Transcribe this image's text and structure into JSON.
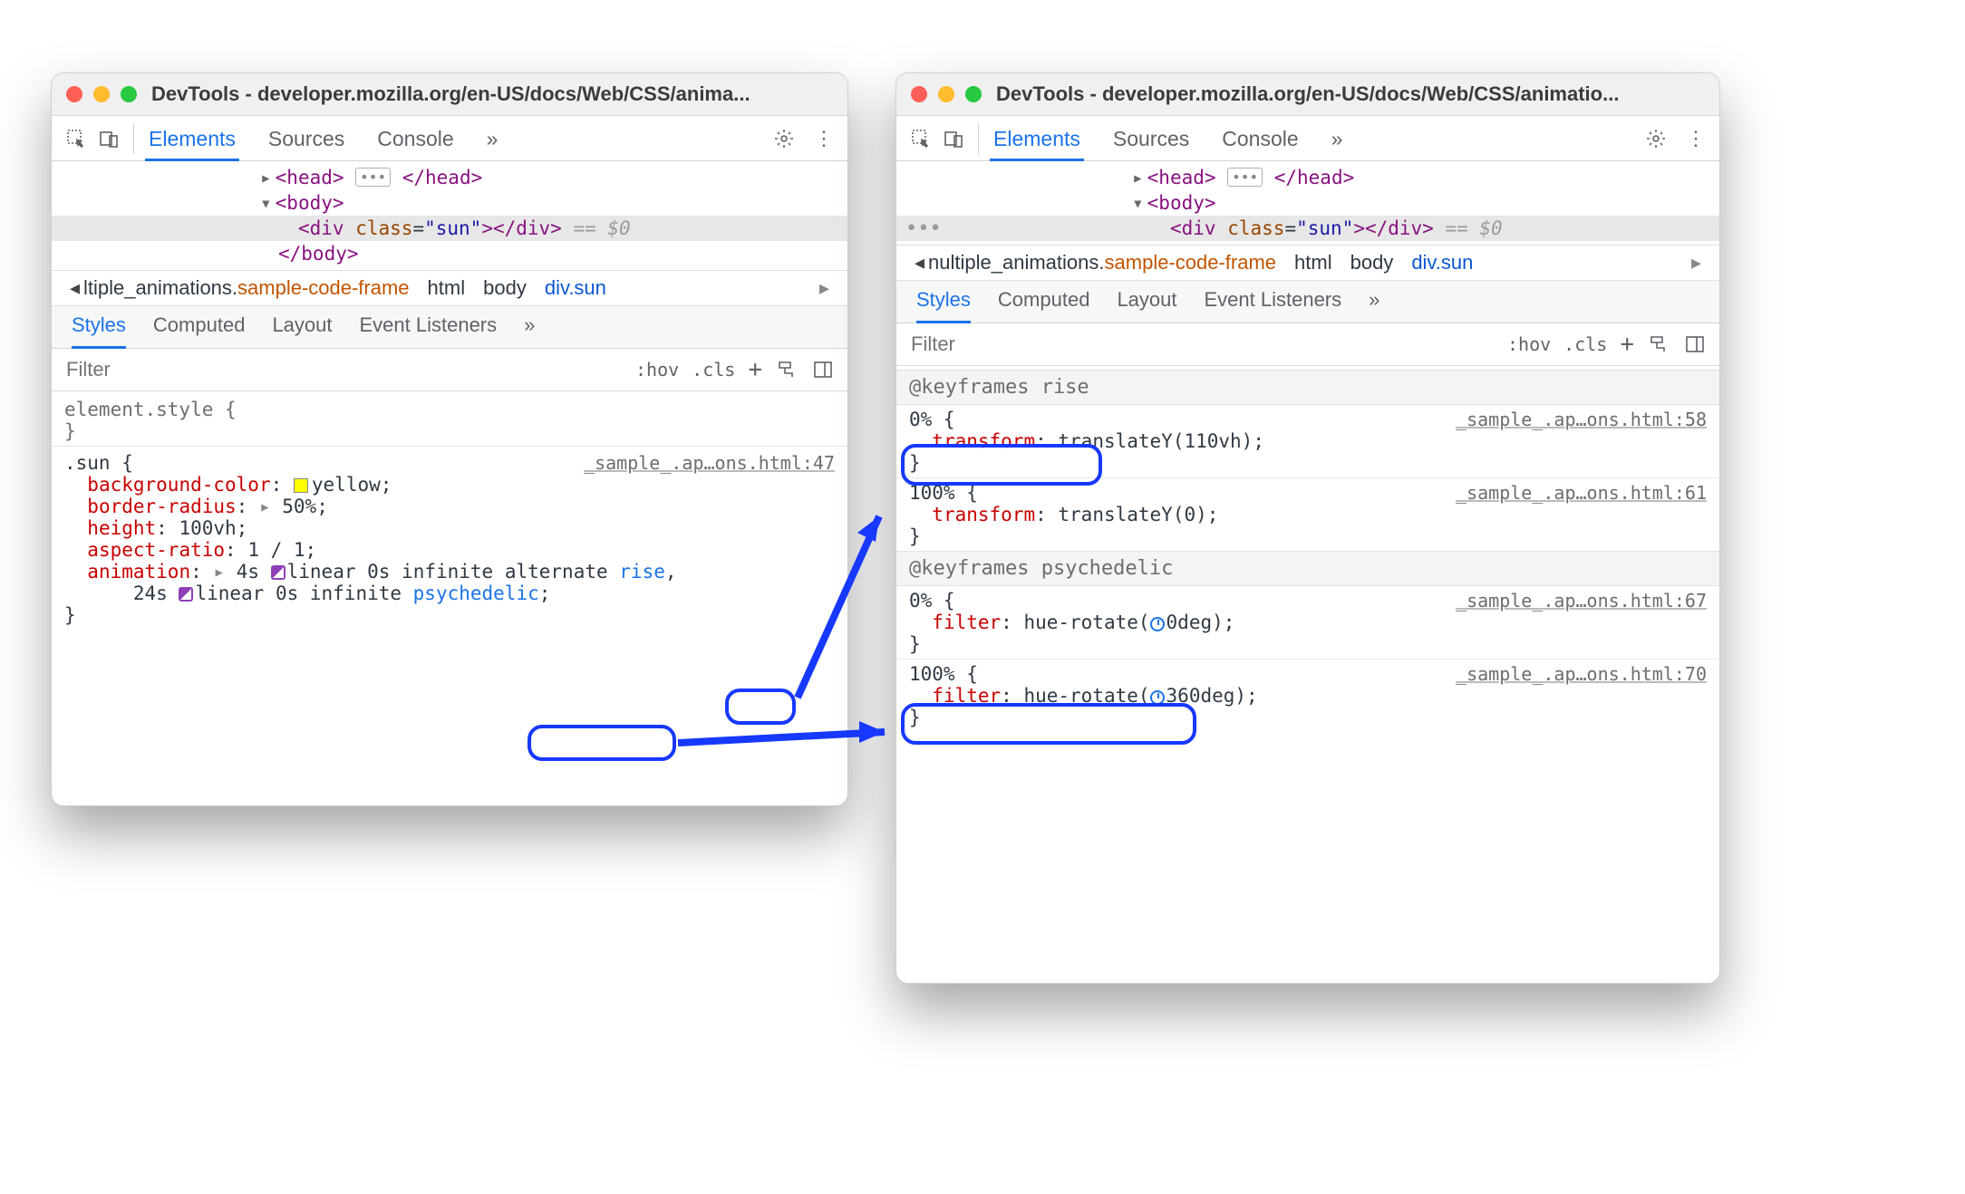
{
  "left": {
    "title": "DevTools - developer.mozilla.org/en-US/docs/Web/CSS/anima...",
    "tabs": {
      "elements": "Elements",
      "sources": "Sources",
      "console": "Console",
      "more": "»"
    },
    "tree": {
      "head_open": "<head>",
      "head_close": "</head>",
      "body_open": "<body>",
      "body_close": "</body>",
      "sel_line": "<div class=\"sun\"></div>",
      "sel_suffix": " == $0"
    },
    "crumbs": {
      "first_a": "ltiple_animations.",
      "first_b": "sample-code-frame",
      "html": "html",
      "body": "body",
      "last": "div.sun"
    },
    "subtabs": {
      "styles": "Styles",
      "computed": "Computed",
      "layout": "Layout",
      "ev": "Event Listeners",
      "more": "»"
    },
    "filter": {
      "placeholder": "Filter",
      "hov": ":hov",
      "cls": ".cls"
    },
    "rules": {
      "elStyle": "element.style {",
      "close": "}",
      "sunSel": ".sun {",
      "sunSrc": "_sample_.ap…ons.html:47",
      "bgProp": "background-color",
      "bgVal": "yellow",
      "brProp": "border-radius",
      "brVal": "50%",
      "hProp": "height",
      "hVal": "100vh",
      "arProp": "aspect-ratio",
      "arVal": "1 / 1",
      "anProp": "animation",
      "anVal1_a": "4s ",
      "anVal1_b": "linear 0s infinite alternate ",
      "anVal1_c": "rise",
      "anVal2_a": "24s ",
      "anVal2_b": "linear 0s infinite ",
      "anVal2_c": "psychedelic"
    }
  },
  "right": {
    "title": "DevTools - developer.mozilla.org/en-US/docs/Web/CSS/animatio...",
    "tabs": {
      "elements": "Elements",
      "sources": "Sources",
      "console": "Console",
      "more": "»"
    },
    "tree": {
      "head_open": "<head>",
      "head_close": "</head>",
      "body_open": "<body>",
      "sel_line": "<div class=\"sun\"></div>",
      "sel_suffix": " == $0"
    },
    "crumbs": {
      "first_a": "nultiple_animations.",
      "first_b": "sample-code-frame",
      "html": "html",
      "body": "body",
      "last": "div.sun"
    },
    "subtabs": {
      "styles": "Styles",
      "computed": "Computed",
      "layout": "Layout",
      "ev": "Event Listeners",
      "more": "»"
    },
    "filter": {
      "placeholder": "Filter",
      "hov": ":hov",
      "cls": ".cls"
    },
    "kf": {
      "rise_hdr": "@keyframes rise",
      "rise_0_sel": "0% {",
      "rise_0_src": "_sample_.ap…ons.html:58",
      "rise_0_prop": "transform",
      "rise_0_val": "translateY(110vh)",
      "rise_100_sel": "100% {",
      "rise_100_src": "_sample_.ap…ons.html:61",
      "rise_100_prop": "transform",
      "rise_100_val": "translateY(0)",
      "psy_hdr": "@keyframes psychedelic",
      "psy_0_sel": "0% {",
      "psy_0_src": "_sample_.ap…ons.html:67",
      "psy_0_prop": "filter",
      "psy_0_val_a": "hue-rotate(",
      "psy_0_val_b": "0deg)",
      "psy_100_sel": "100% {",
      "psy_100_src": "_sample_.ap…ons.html:70",
      "psy_100_prop": "filter",
      "psy_100_val_a": "hue-rotate(",
      "psy_100_val_b": "360deg)",
      "close": "}"
    }
  }
}
